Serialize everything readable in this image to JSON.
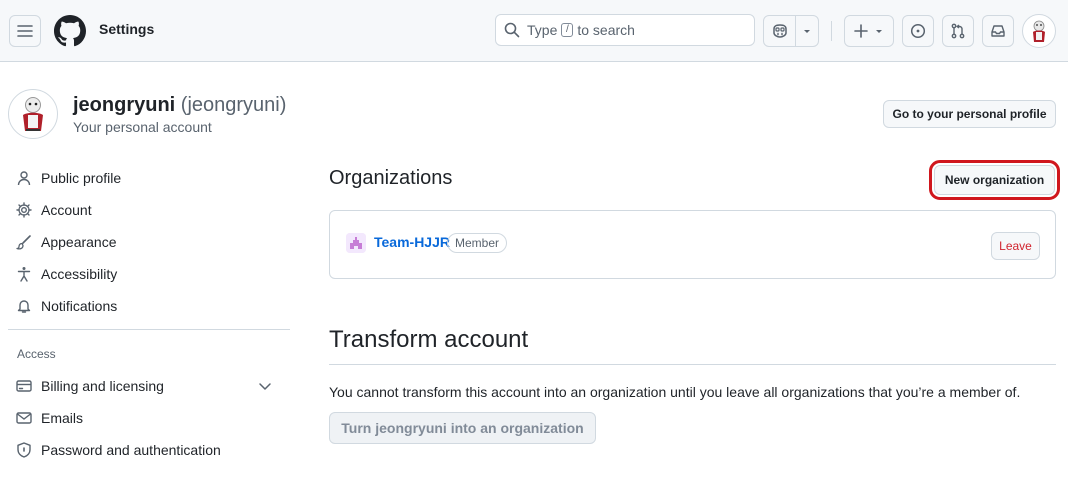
{
  "header": {
    "title": "Settings",
    "search": {
      "prefix": "Type",
      "key": "/",
      "suffix": "to search"
    },
    "icons": [
      "menu-icon",
      "github-logo",
      "search-icon",
      "copilot-icon",
      "chevron-down-icon",
      "plus-icon",
      "issues-icon",
      "pull-requests-icon",
      "inbox-icon",
      "avatar"
    ]
  },
  "profile": {
    "display_name": "jeongryuni",
    "login": "(jeongryuni)",
    "account_type": "Your personal account",
    "goto_button": "Go to your personal profile"
  },
  "sidebar": {
    "items": [
      {
        "label": "Public profile",
        "icon": "person-icon"
      },
      {
        "label": "Account",
        "icon": "gear-icon"
      },
      {
        "label": "Appearance",
        "icon": "paintbrush-icon"
      },
      {
        "label": "Accessibility",
        "icon": "accessibility-icon"
      },
      {
        "label": "Notifications",
        "icon": "bell-icon"
      }
    ],
    "access_heading": "Access",
    "access_items": [
      {
        "label": "Billing and licensing",
        "icon": "credit-card-icon",
        "expandable": true
      },
      {
        "label": "Emails",
        "icon": "mail-icon"
      },
      {
        "label": "Password and authentication",
        "icon": "shield-icon"
      }
    ]
  },
  "organizations": {
    "heading": "Organizations",
    "new_button": "New organization",
    "items": [
      {
        "name": "Team-HJJR",
        "role": "Member",
        "action": "Leave"
      }
    ]
  },
  "transform": {
    "heading": "Transform account",
    "message": "You cannot transform this account into an organization until you leave all organizations that you’re a member of.",
    "button": "Turn jeongryuni into an organization"
  },
  "colors": {
    "accent_link": "#0969da",
    "danger": "#d1242f",
    "highlight_box": "#d0161d"
  }
}
